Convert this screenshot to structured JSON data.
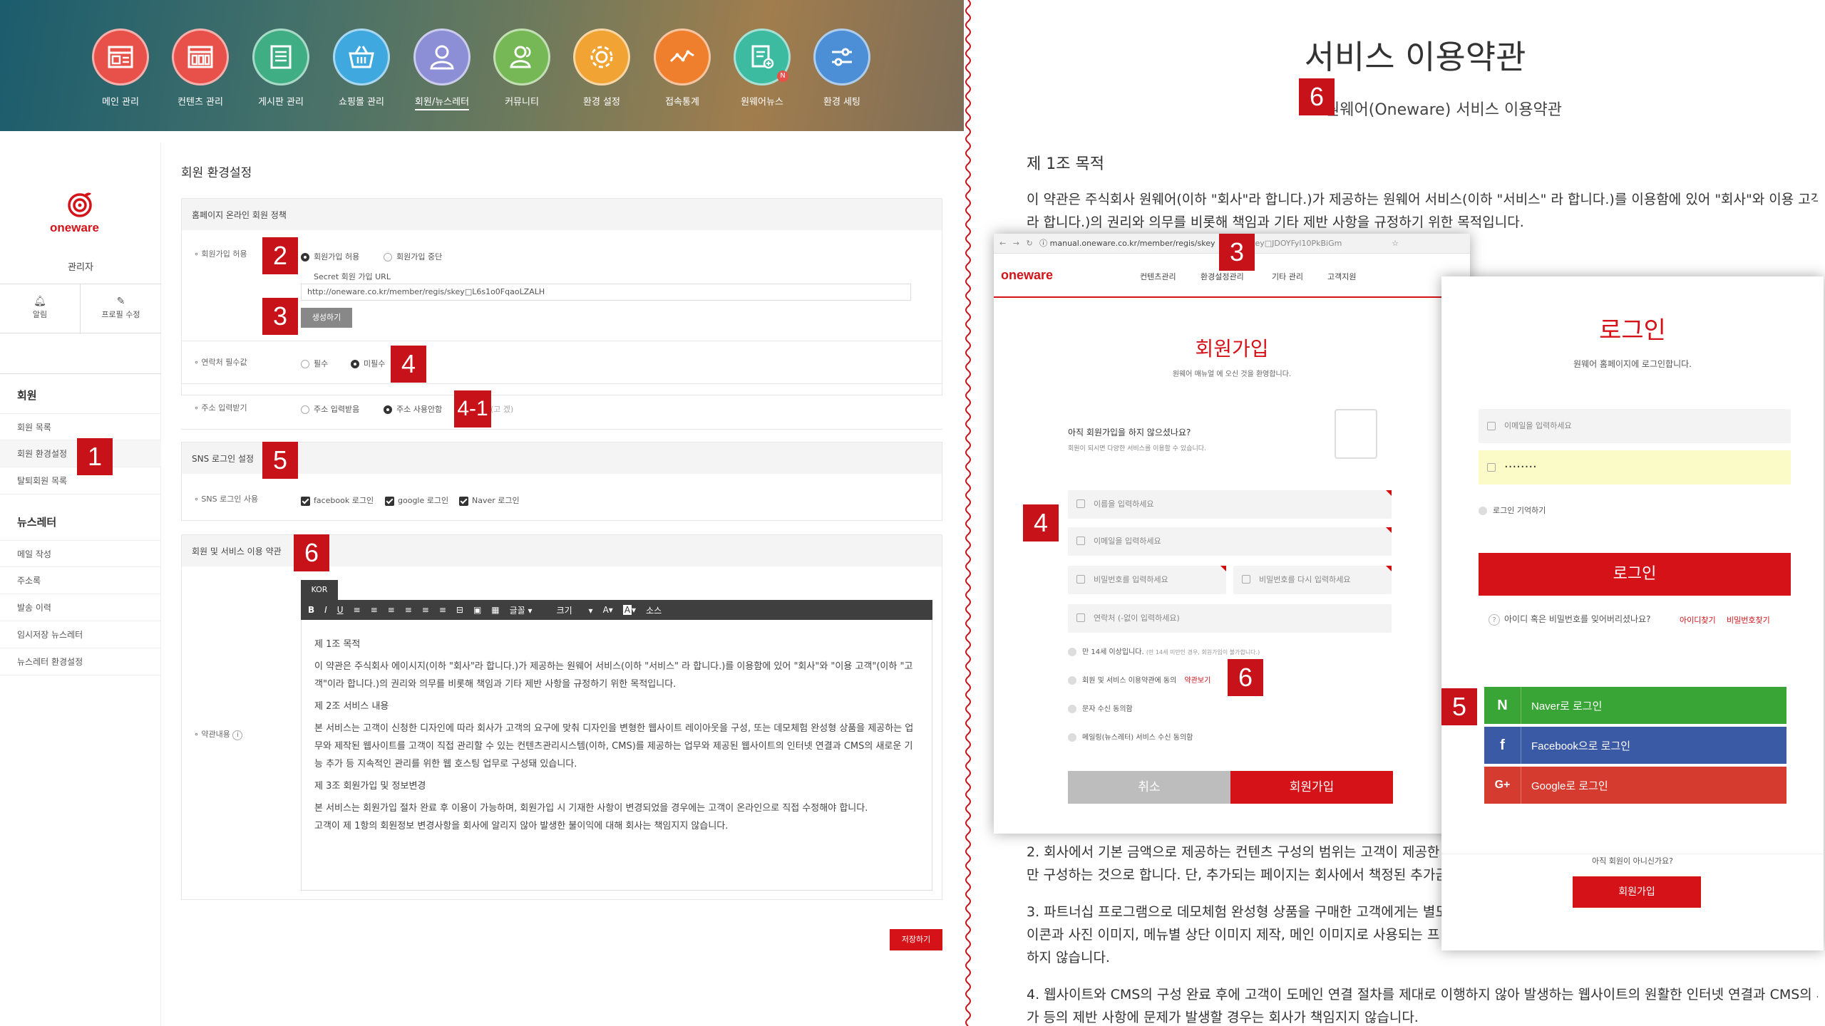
{
  "admin": {
    "menu": [
      {
        "label": "메인 관리",
        "color": "#e8504a",
        "icon": "layout-icon"
      },
      {
        "label": "컨텐츠 관리",
        "color": "#e8504a",
        "icon": "grid-icon"
      },
      {
        "label": "게시판 관리",
        "color": "#3fae84",
        "icon": "list-icon"
      },
      {
        "label": "쇼핑몰 관리",
        "color": "#3fa8df",
        "icon": "basket-icon"
      },
      {
        "label": "회원/뉴스레터",
        "color": "#8c8fd6",
        "icon": "user-icon"
      },
      {
        "label": "커뮤니티",
        "color": "#76b856",
        "icon": "users-icon"
      },
      {
        "label": "환경 설정",
        "color": "#f1a433",
        "icon": "gear-icon"
      },
      {
        "label": "접속통계",
        "color": "#f07f2d",
        "icon": "chart-icon"
      },
      {
        "label": "원웨어뉴스",
        "color": "#3dbba0",
        "icon": "news-icon"
      },
      {
        "label": "환경 세팅",
        "color": "#4d8fd6",
        "icon": "sliders-icon"
      }
    ],
    "news_badge": "N",
    "logo": "oneware",
    "role": "관리자",
    "alarm_label": "알림",
    "profile_label": "프로필 수정",
    "sidebar": {
      "member_section": "회원",
      "member_items": [
        "회원 목록",
        "회원 환경설정",
        "탈퇴회원 목록"
      ],
      "newsletter_section": "뉴스레터",
      "newsletter_items": [
        "메일 작성",
        "주소록",
        "발송 이력",
        "임시저장 뉴스레터",
        "뉴스레터 환경설정"
      ]
    },
    "page_title": "회원 환경설정",
    "online_policy": "홈페이지 온라인 회원 정책",
    "signup_allow_label": "회원가입 허용",
    "signup_allow": "회원가입 허용",
    "signup_stop": "회원가입 중단",
    "secret_url_label": "Secret 회원 가입 URL",
    "secret_url": "http://oneware.co.kr/member/regis/skey□L6s1o0FqaoLZALH",
    "generate_button": "생성하기",
    "contact_label": "연락처 필수값",
    "required": "필수",
    "not_required": "미필수",
    "address_label": "주소 입력받기",
    "address_receive": "주소 입력받음",
    "address_unused": "주소 사용안함",
    "address_hint": "(고 겠)",
    "sns_header": "SNS 로그인 설정",
    "sns_use_label": "SNS 로그인 사용",
    "sns_options": [
      "facebook 로그인",
      "google 로그인",
      "Naver 로그인"
    ],
    "terms_header": "회원 및 서비스 이용 약관",
    "terms_label": "약관내용",
    "editor_tab": "KOR",
    "editor_tools": [
      "B",
      "I",
      "U",
      "≡",
      "≡",
      "≡",
      "≡",
      "≡",
      "≡",
      "⊟",
      "▣",
      "▦",
      "글꼴",
      "크기",
      "A",
      "A",
      "소스"
    ],
    "editor_content": [
      "제 1조 목적",
      "이 약관은 주식회사 에이시지(이하 \"회사\"라 합니다.)가 제공하는 원웨어 서비스(이하 \"서비스\" 라 합니다.)를 이용함에 있어 \"회사\"와 \"이용 고객\"(이하 \"고객\"이라 합니다.)의 권리와 의무를 비롯해 책임과 기타 제반 사항을 규정하기 위한 목적입니다.",
      "제 2조 서비스 내용",
      "본 서비스는 고객이 신청한 디자인에 따라 회사가 고객의 요구에 맞춰 디자인을 변형한 웹사이트 레이아웃을 구성, 또는 데모체험 완성형 상품을 제공하는 업무와 제작된 웹사이트를 고객이 직접 관리할 수 있는 컨텐츠관리시스템(이하, CMS)를 제공하는 업무와 제공된 웹사이트의 인터넷 연결과 CMS의 새로운 기능 추가 등 지속적인 관리를 위한 웹 호스팅 업무로 구성돼 있습니다.",
      "제 3조 회원가입 및 정보변경",
      "본 서비스는 회원가입 절차 완료 후 이용이 가능하며, 회원가입 시 기재한 사항이 변경되었을 경우에는 고객이 온라인으로 직접 수정해야 합니다.",
      "고객이 제 1항의 회원정보 변경사항을 회사에 알리지 않아 발생한 불이익에 대해 회사는 책임지지 않습니다."
    ],
    "save_button": "저장하기"
  },
  "terms": {
    "title": "서비스 이용약관",
    "subtitle": "원웨어(Oneware) 서비스 이용약관",
    "article1": "제 1조 목적",
    "article1_line1": "이 약관은 주식회사 원웨어(이하 \"회사\"라 합니다.)가 제공하는 원웨어 서비스(이하 \"서비스\" 라 합니다.)를 이용함에 있어 \"회사\"와 이용 고객 (이",
    "article1_line2": "라 합니다.)의 권리와 의무를 비롯해 책임과 기타 제반 사항을 규정하기 위한 목적입니다.",
    "p2a": "2. 회사에서 기본 금액으로 제공하는 컨텐츠 구성의 범위는 고객이 제공한",
    "p2b": "만 구성하는 것으로 합니다. 단, 추가되는 페이지는 회사에서 책정된 추가금",
    "p3a": "3. 파트너십 프로그램으로 데모체험 완성형 상품을 구매한 고객에게는 별도",
    "p3b": "이콘과 사진 이미지, 메뉴별 상단 이미지 제작, 메인 이미지로 사용되는 프",
    "p3c": "하지 않습니다.",
    "p4a": "4. 웹사이트와 CMS의 구성 완료 후에 고객이 도메인 연결 절차를 제대로 이행하지 않아 발생하는 웹사이트의 원활한 인터넷 연결과 CMS의 새",
    "p4b": "가 등의 제반 사항에 문제가 발생할 경우는 회사가 책임지지 않습니다."
  },
  "browser": {
    "url": "manual.oneware.co.kr/member/regis/skey",
    "url_rest": "key□JDOYFyl10PkBiGm",
    "logo": "oneware",
    "nav": [
      "컨텐츠관리",
      "환경설정관리",
      "기타 관리",
      "고객지원"
    ],
    "signup_title": "회원가입",
    "signup_sub": "원웨어 매뉴얼 에 오신 것을 환영합니다.",
    "question": "아직 회원가입을 하지 않으셨나요?",
    "question_sub": "회원이 되시면 다양한 서비스를 이용할 수 있습니다.",
    "fields": {
      "name": "이름을 입력하세요",
      "email": "이메일을 입력하세요",
      "password": "비밀번호를 입력하세요",
      "password2": "비밀번호를 다시 입력하세요",
      "phone": "연락처 (-없이 입력하세요)"
    },
    "age": "만 14세 이상입니다.",
    "age_note": "(만 14세 미만인 경우, 회원가입이 불가합니다.)",
    "agree_terms": "회원 및 서비스 이용약관에 동의",
    "view_terms": "약관보기",
    "agree_sms": "문자 수신 동의함",
    "agree_mail": "메일링(뉴스레터) 서비스 수신 동의함",
    "cancel": "취소",
    "submit": "회원가입"
  },
  "login": {
    "title": "로그인",
    "sub": "원웨어 홈페이지에 로그인합니다.",
    "email_placeholder": "이메일을 입력하세요",
    "password_value": "········",
    "remember": "로그인 기억하기",
    "login_button": "로그인",
    "forgot": "아이디 혹은 비밀번호를 잊어버리셨나요?",
    "find_id": "아이디찾기",
    "find_pw": "비밀번호찾기",
    "naver": "Naver로 로그인",
    "facebook": "Facebook으로 로그인",
    "google": "Google로 로그인",
    "no_account": "아직 회원이 아니신가요?",
    "signup_button": "회원가입"
  },
  "badges": {
    "b1": "1",
    "b2": "2",
    "b3": "3",
    "b4": "4",
    "b41": "4-1",
    "b5": "5",
    "b6": "6"
  },
  "colors": {
    "accent": "#d51218",
    "naver": "#3aa537",
    "facebook": "#3b5aa6",
    "google": "#d63b2f"
  }
}
